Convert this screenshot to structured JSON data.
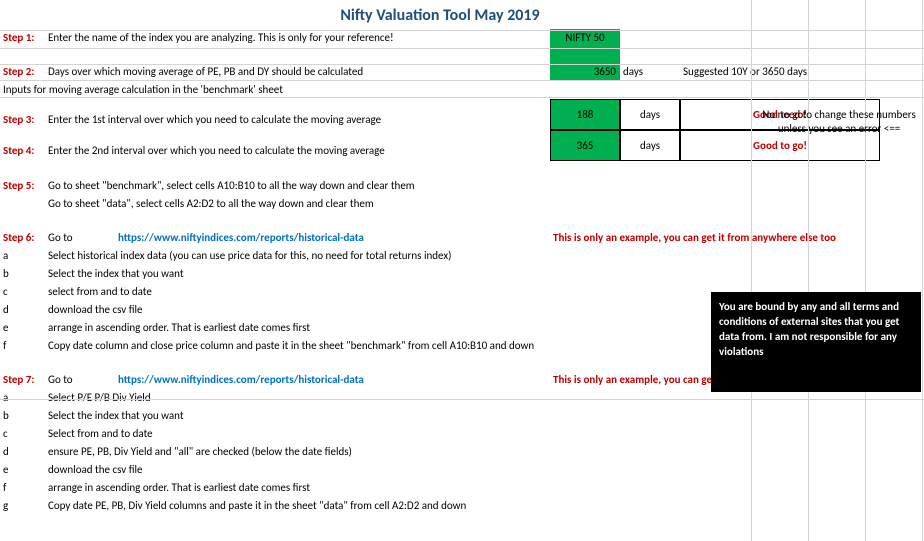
{
  "title": "Nifty Valuation Tool May 2019",
  "step1": {
    "label": "Step 1:",
    "text": "Enter the name of the index you are analyzing. This is only for your reference!",
    "value": "NIFTY 50"
  },
  "step2": {
    "label": "Step 2:",
    "text": "Days over which moving average of PE, PB and DY should be calculated",
    "value": "3650",
    "unit": "days",
    "suggest": "Suggested 10Y or 3650 days"
  },
  "inputs_note": "Inputs for moving average calculation in the 'benchmark' sheet",
  "step3": {
    "label": "Step 3:",
    "text": "Enter the 1st interval over which you need to calculate the moving average",
    "value": "188",
    "unit": "days",
    "status": "Good to go!"
  },
  "step4": {
    "label": "Step 4:",
    "text": "Enter the 2nd interval over which you need to calculate the moving average",
    "value": "365",
    "unit": "days",
    "status": "Good to go!"
  },
  "side_note": "No need to change these numbers unless you see an error <==",
  "step5": {
    "label": "Step 5:",
    "lines": [
      "Go to sheet \"benchmark\", select cells A10:B10 to all the way down and clear them",
      "Go to sheet \"data\", select cells A2:D2 to all the way down and clear them"
    ]
  },
  "step6": {
    "label": "Step 6:",
    "goto": "Go to",
    "url": "https://www.niftyindices.com/reports/historical-data",
    "example_note": "This is only an example, you can get it from anywhere else too",
    "items": {
      "a": "Select historical index data (you can use price data for this, no need for total returns index)",
      "b": "Select the index that you want",
      "c": "select from and to date",
      "d": "download the csv file",
      "e": "arrange in ascending order. That is earliest date comes first",
      "f": "Copy date column and close price column and paste it in the sheet \"benchmark\" from cell A10:B10 and down"
    }
  },
  "step7": {
    "label": "Step 7:",
    "goto": "Go to",
    "url": "https://www.niftyindices.com/reports/historical-data",
    "example_note": "This is only an example, you can get it from anywhere else too",
    "items": {
      "a": "Select P/E P/B Div Yield",
      "b": "Select the index that you want",
      "c": "Select from and to date",
      "d": "ensure PE, PB, Div Yield and \"all\" are checked (below the date fields)",
      "e": "download the csv file",
      "f": "arrange in ascending order. That is earliest date comes first",
      "g": "Copy date PE, PB, Div Yield  columns and paste it in the sheet \"data\" from cell A2:D2 and down"
    }
  },
  "disclaimer": "You are bound by any and all terms and conditions of external sites that you get data from. I am not responsible for any violations"
}
